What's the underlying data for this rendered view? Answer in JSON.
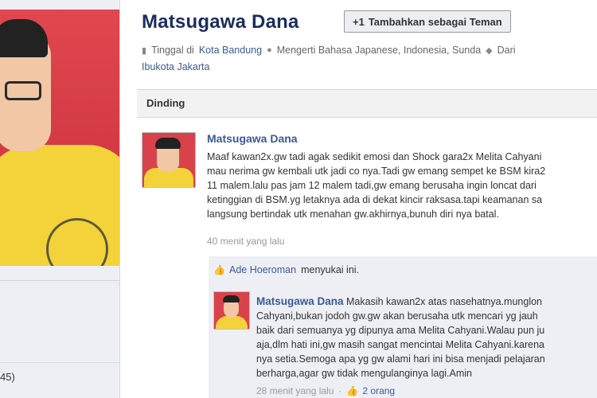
{
  "profile": {
    "name": "Matsugawa Dana",
    "add_friend_label": "Tambahkan sebagai Teman",
    "add_friend_icon": "add-friend-icon",
    "info": {
      "lives_label": "Tinggal di",
      "lives_city": "Kota Bandung",
      "languages": "Mengerti Bahasa Japanese, Indonesia, Sunda",
      "from_label": "Dari",
      "from_place": "Ibukota Jakarta"
    }
  },
  "left": {
    "count_text": "45)"
  },
  "tabs": {
    "wall": "Dinding"
  },
  "post": {
    "author": "Matsugawa Dana",
    "lines": [
      "Maaf kawan2x.gw tadi agak sedikit emosi dan Shock gara2x Melita Cahyani",
      "mau nerima gw kembali utk jadi co nya.Tadi gw emang sempet ke BSM kira2",
      "11 malem.lalu pas jam  12 malem tadi,gw emang berusaha ingin loncat dari",
      "ketinggian di BSM.yg letaknya ada di dekat kincir raksasa.tapi keamanan sa",
      "langsung bertindak utk menahan gw.akhirnya,bunuh diri nya batal."
    ],
    "time": "40 menit yang lalu",
    "likes": {
      "name": "Ade Hoeroman",
      "suffix": "menyukai ini."
    }
  },
  "comment": {
    "author": "Matsugawa Dana",
    "first_line": "Makasih kawan2x atas nasehatnya.munglon",
    "lines": [
      "Cahyani,bukan jodoh gw.gw akan berusaha utk mencari yg jauh",
      "baik dari semuanya yg dipunya ama Melita Cahyani.Walau pun ju",
      "aja,dlm hati ini,gw masih sangat mencintai Melita Cahyani.karena",
      "nya setia.Semoga apa yg gw alami hari ini bisa menjadi pelajaran",
      "berharga,agar gw tidak mengulanginya lagi.Amin"
    ],
    "time": "28 menit yang lalu",
    "like_count": "2 orang"
  }
}
